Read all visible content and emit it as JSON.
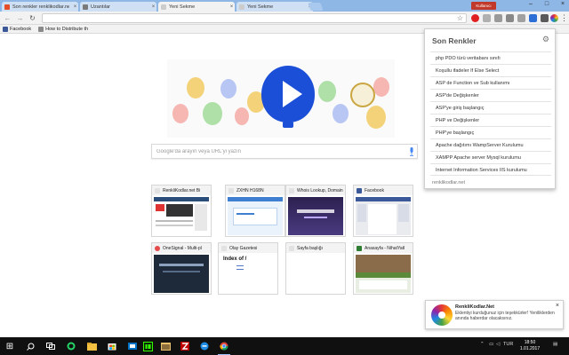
{
  "browser": {
    "tabs": [
      {
        "label": "Son renkler renklikodlar.net",
        "favicon_color": "#e44d26",
        "active": false
      },
      {
        "label": "Uzantılar",
        "favicon_color": "#7a7a7a",
        "active": false
      },
      {
        "label": "Yeni Sekme",
        "favicon_color": "#cccccc",
        "active": true
      },
      {
        "label": "Yeni Sekme",
        "favicon_color": "#cccccc",
        "active": false
      }
    ],
    "close_glyph": "×",
    "profile_label": "Kullanıcı",
    "window_controls": [
      "–",
      "□",
      "×"
    ],
    "address_value": "",
    "star_glyph": "☆",
    "menu_glyph": "⋮",
    "nav_glyphs": {
      "back": "←",
      "forward": "→",
      "reload": "↻"
    }
  },
  "bookmarks": [
    {
      "label": "Facebook",
      "favicon_color": "#3b5998"
    },
    {
      "label": "How to Distribute th",
      "favicon_color": "#8a8a8a"
    }
  ],
  "search": {
    "placeholder": "Google'da arayın veya URL'yi yazın"
  },
  "tiles": [
    {
      "title": "RenkliKodlar.net Bi",
      "favicon_color": "#e2e2e2",
      "thumb": "#2a4d7a"
    },
    {
      "title": "ZXHN H168N",
      "favicon_color": "#e2e2e2",
      "thumb": "#3f7fcf"
    },
    {
      "title": "Whois Lookup, Domain",
      "favicon_color": "#e2e2e2",
      "thumb": "#3b2a66"
    },
    {
      "title": "Facebook",
      "favicon_color": "#3b5998",
      "thumb": "#3b5998"
    },
    {
      "title": "OneSignal - Multi-pl",
      "favicon_color": "#e54b4d",
      "thumb": "#1e2a3a"
    },
    {
      "title": "Olay Gazetesi",
      "favicon_color": "#e2e2e2",
      "thumb": "#ffffff"
    },
    {
      "title": "Sayfa başlığı",
      "favicon_color": "#e2e2e2",
      "thumb": "#ffffff"
    },
    {
      "title": "Anasayfa - NihatYatl",
      "favicon_color": "#2e7d32",
      "thumb": "#5b8a3a"
    }
  ],
  "tile_extra": {
    "index_of": "Index of /"
  },
  "popup": {
    "title": "Son Renkler",
    "items": [
      "php PDO türü veritabanı sınıfı",
      "Koşullu ifadeler If Else Select",
      "ASP de Function ve Sub kullanımı",
      "ASP'de Değişkenler",
      "ASP'ye giriş başlangıç",
      "PHP ve Değişkenler",
      "PHP'ye başlangıç",
      "Apache dağıtımı WampServer Kurulumu",
      "XAMPP Apache server Mysql kurulumu",
      "Internet Information Services IIS kurulumu"
    ],
    "footer": "renklikodlar.net",
    "gear_glyph": "⚙"
  },
  "notification": {
    "title": "RenkliKodlar.Net",
    "body": "Eklentiyi kurduğunuz için teşekkürler! Yeniliklerden anında haberdar olacaksınız.",
    "close_glyph": "×"
  },
  "taskbar": {
    "start_glyph": "⊞",
    "language": "TUR",
    "time": "18:50",
    "date": "1.01.2017"
  },
  "colors": {
    "tabstrip": "#8fb7e6",
    "doodle_balloon": "#1c4fd8",
    "popup_border": "#cfcfcf",
    "taskbar": "#101010"
  }
}
